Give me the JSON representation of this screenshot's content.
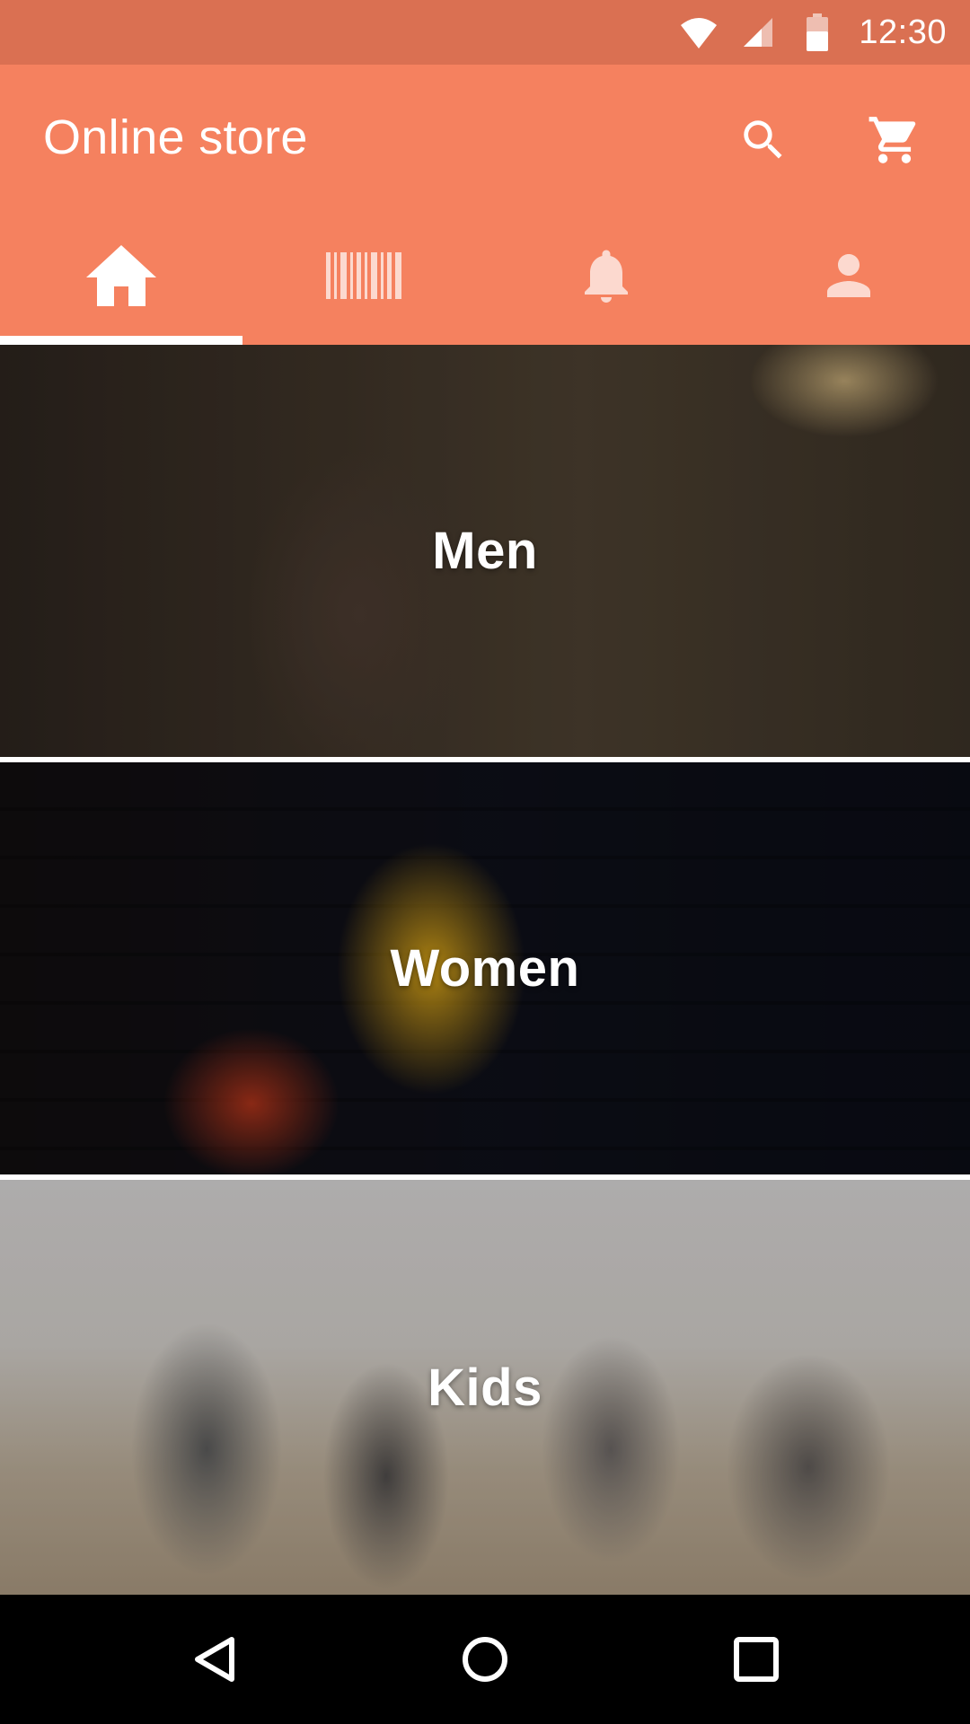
{
  "status_bar": {
    "time": "12:30",
    "icons": [
      "wifi-icon",
      "signal-icon",
      "battery-icon"
    ]
  },
  "app_bar": {
    "title": "Online store",
    "actions": [
      "search-icon",
      "cart-icon"
    ],
    "background": "#F5815F"
  },
  "tabs": [
    {
      "icon": "home-icon",
      "active": true
    },
    {
      "icon": "barcode-icon",
      "active": false
    },
    {
      "icon": "bell-icon",
      "active": false
    },
    {
      "icon": "person-icon",
      "active": false
    }
  ],
  "categories": [
    {
      "label": "Men"
    },
    {
      "label": "Women"
    },
    {
      "label": "Kids"
    }
  ],
  "nav_bar": {
    "buttons": [
      "back-icon",
      "home-circle-icon",
      "recents-icon"
    ]
  }
}
